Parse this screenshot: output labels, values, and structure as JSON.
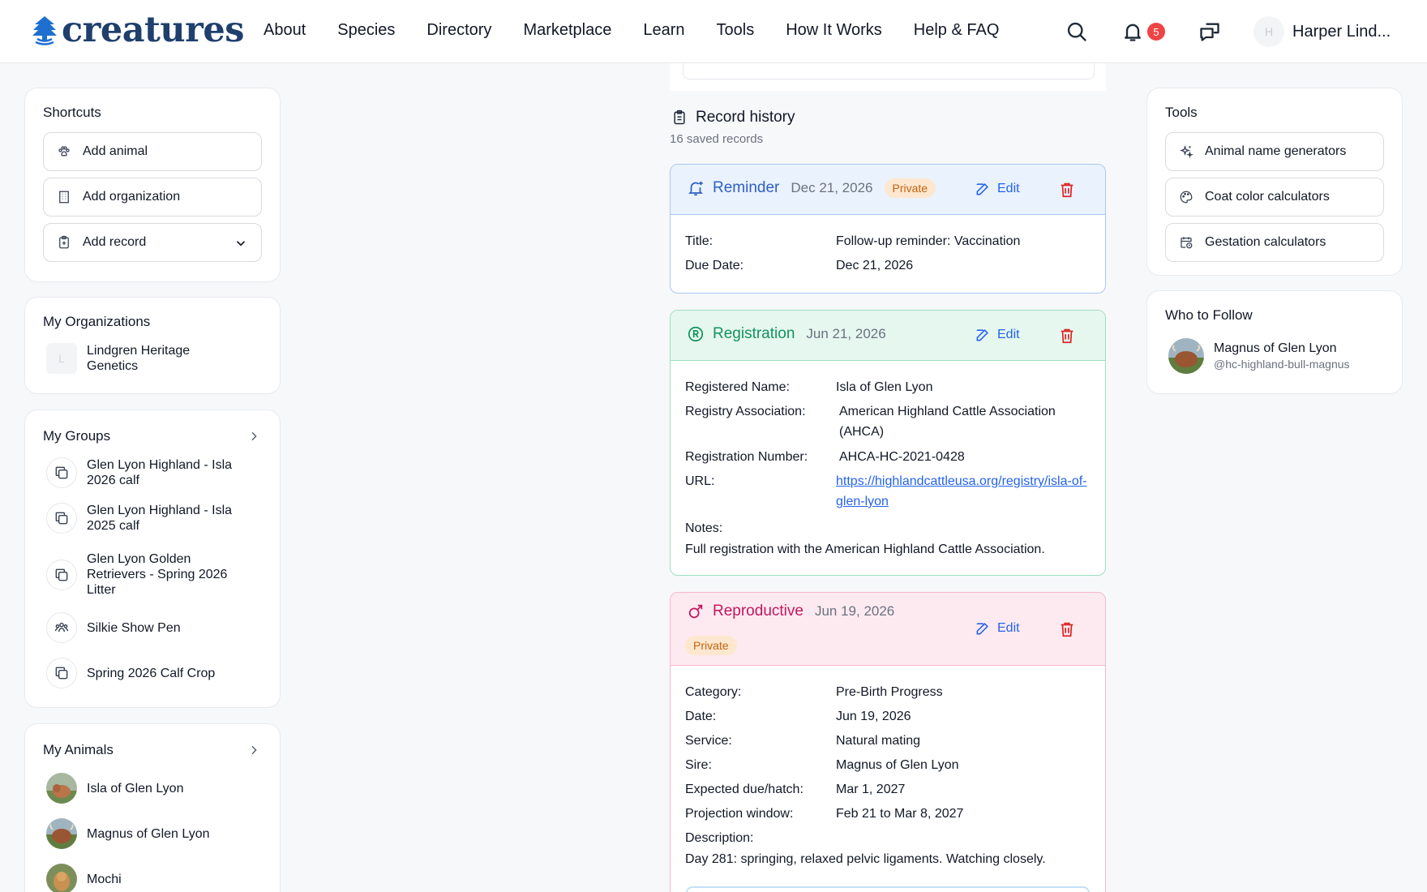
{
  "header": {
    "brand": "creatures",
    "nav": [
      "About",
      "Species",
      "Directory",
      "Marketplace",
      "Learn",
      "Tools",
      "How It Works",
      "Help & FAQ"
    ],
    "notifications_count": "5",
    "user_initial": "H",
    "user_name": "Harper Lind..."
  },
  "shortcuts": {
    "title": "Shortcuts",
    "items": [
      "Add animal",
      "Add organization",
      "Add record"
    ]
  },
  "organizations": {
    "title": "My Organizations",
    "items": [
      {
        "initial": "L",
        "name": "Lindgren Heritage Genetics"
      }
    ]
  },
  "groups": {
    "title": "My Groups",
    "items": [
      "Glen Lyon Highland - Isla 2026 calf",
      "Glen Lyon Highland - Isla 2025 calf",
      "Glen Lyon Golden Retrievers - Spring 2026 Litter",
      "Silkie Show Pen",
      "Spring 2026 Calf Crop"
    ]
  },
  "animals": {
    "title": "My Animals",
    "items": [
      "Isla of Glen Lyon",
      "Magnus of Glen Lyon",
      "Mochi"
    ]
  },
  "record_history": {
    "title": "Record history",
    "subtitle": "16 saved records",
    "edit_label": "Edit",
    "private_label": "Private",
    "reminder": {
      "type": "Reminder",
      "date": "Dec 21, 2026",
      "fields": [
        {
          "label": "Title:",
          "value": "Follow-up reminder: Vaccination"
        },
        {
          "label": "Due Date:",
          "value": "Dec 21, 2026"
        }
      ]
    },
    "registration": {
      "type": "Registration",
      "date": "Jun 21, 2026",
      "fields": [
        {
          "label": "Registered Name:",
          "value": "Isla of Glen Lyon"
        },
        {
          "label": "Registry Association:",
          "value": "American Highland Cattle Association (AHCA)"
        },
        {
          "label": "Registration Number:",
          "value": "AHCA-HC-2021-0428"
        },
        {
          "label": "URL:",
          "value": "https://highlandcattleusa.org/registry/isla-of-glen-lyon"
        }
      ],
      "notes_label": "Notes:",
      "notes": "Full registration with the American Highland Cattle Association."
    },
    "reproductive": {
      "type": "Reproductive",
      "date": "Jun 19, 2026",
      "fields": [
        {
          "label": "Category:",
          "value": "Pre-Birth Progress"
        },
        {
          "label": "Date:",
          "value": "Jun 19, 2026"
        },
        {
          "label": "Service:",
          "value": "Natural mating"
        },
        {
          "label": "Sire:",
          "value": "Magnus of Glen Lyon"
        },
        {
          "label": "Expected due/hatch:",
          "value": "Mar 1, 2027"
        },
        {
          "label": "Projection window:",
          "value": "Feb 21 to Mar 8, 2027"
        }
      ],
      "description_label": "Description:",
      "description": "Day 281: springing, relaxed pelvic ligaments. Watching closely."
    }
  },
  "tools": {
    "title": "Tools",
    "items": [
      "Animal name generators",
      "Coat color calculators",
      "Gestation calculators"
    ]
  },
  "who_to_follow": {
    "title": "Who to Follow",
    "items": [
      {
        "name": "Magnus of Glen Lyon",
        "handle": "@hc-highland-bull-magnus"
      }
    ]
  },
  "colors": {
    "reminder_accent": "#2f5fc4",
    "registration_accent": "#14935e",
    "reproductive_accent": "#c2185b",
    "link": "#2563eb",
    "delete": "#dc2626"
  }
}
